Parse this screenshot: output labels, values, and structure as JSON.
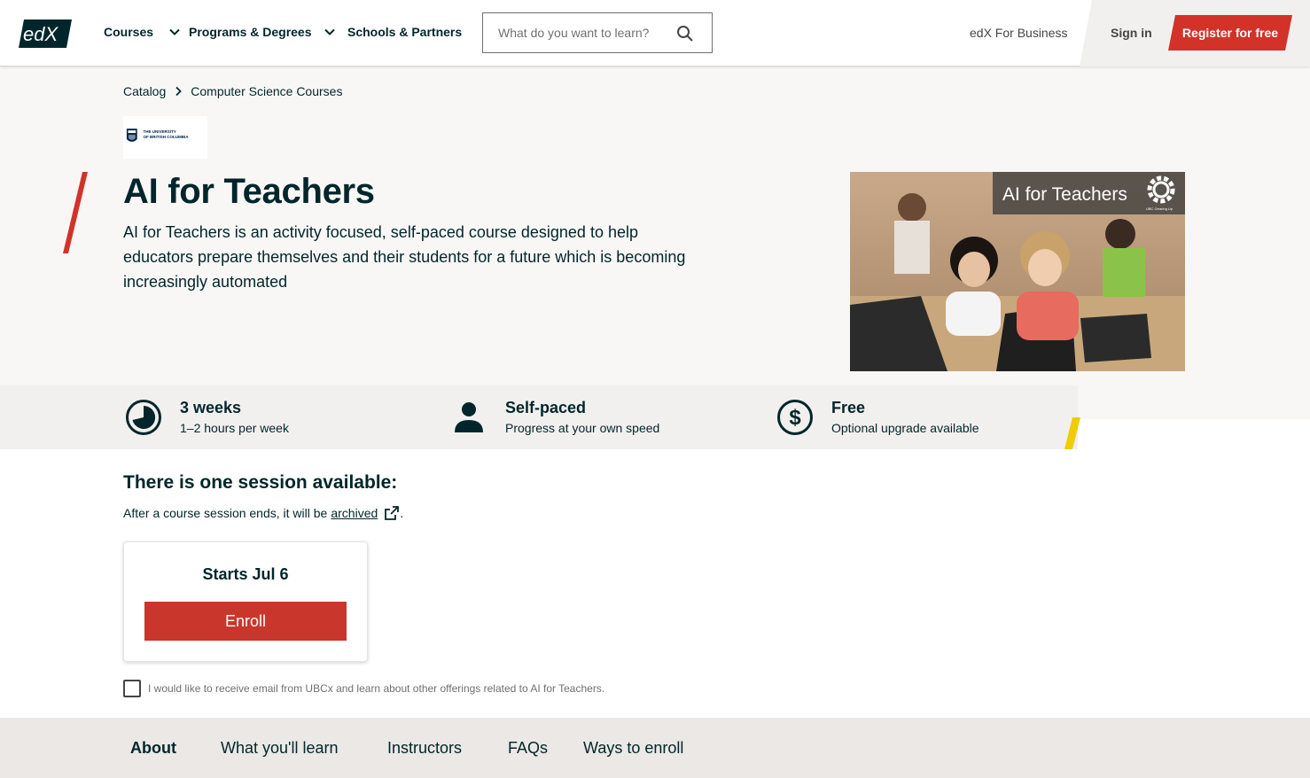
{
  "header": {
    "logo_text": "edX",
    "nav": [
      {
        "label": "Courses"
      },
      {
        "label": "Programs & Degrees"
      },
      {
        "label": "Schools & Partners"
      }
    ],
    "search_placeholder": "What do you want to learn?",
    "business_label": "edX For Business",
    "signin_label": "Sign in",
    "register_label": "Register for free"
  },
  "breadcrumb": [
    "Catalog",
    "Computer Science Courses"
  ],
  "org_logo_text": [
    "THE UNIVERSITY",
    "OF BRITISH COLUMBIA"
  ],
  "course": {
    "title": "AI for Teachers",
    "description": "AI for Teachers is an activity focused, self-paced course designed to help educators prepare themselves and their students for a future which is becoming increasingly automated",
    "image_caption": "AI for Teachers",
    "image_badge_text": "UBC Gearing Up"
  },
  "stats": [
    {
      "title": "3 weeks",
      "subtitle": "1–2 hours per week",
      "icon": "clock-icon"
    },
    {
      "title": "Self-paced",
      "subtitle": "Progress at your own speed",
      "icon": "person-icon"
    },
    {
      "title": "Free",
      "subtitle": "Optional upgrade available",
      "icon": "dollar-icon"
    }
  ],
  "session": {
    "heading": "There is one session available:",
    "note_prefix": "After a course session ends, it will be",
    "note_link": "archived",
    "note_suffix": ".",
    "start_label": "Starts Jul 6",
    "enroll_label": "Enroll",
    "consent_text": "I would like to receive email from UBCx and learn about other offerings related to AI for Teachers."
  },
  "tabs": [
    {
      "label": "About",
      "active": true
    },
    {
      "label": "What you'll learn",
      "active": false
    },
    {
      "label": "Instructors",
      "active": false
    },
    {
      "label": "FAQs",
      "active": false
    },
    {
      "label": "Ways to enroll",
      "active": false
    }
  ],
  "colors": {
    "primary": "#00262b",
    "brand_red": "#d23228",
    "enroll_red": "#c9372c",
    "accent_yellow": "#f0cc00"
  }
}
